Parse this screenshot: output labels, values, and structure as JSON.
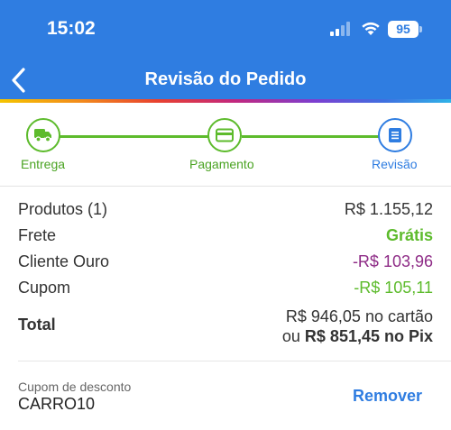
{
  "status_bar": {
    "time": "15:02",
    "battery": "95",
    "icons": [
      "signal-icon",
      "wifi-icon",
      "battery-icon"
    ]
  },
  "header": {
    "title": "Revisão do Pedido",
    "back_icon": "chevron-left-icon"
  },
  "stepper": {
    "steps": [
      {
        "label": "Entrega",
        "icon": "truck-icon",
        "state": "done"
      },
      {
        "label": "Pagamento",
        "icon": "card-icon",
        "state": "done"
      },
      {
        "label": "Revisão",
        "icon": "document-icon",
        "state": "current"
      }
    ]
  },
  "summary": {
    "rows": [
      {
        "label": "Produtos (1)",
        "value": "R$ 1.155,12"
      },
      {
        "label": "Frete",
        "value": "Grátis"
      },
      {
        "label": "Cliente Ouro",
        "value": "-R$ 103,96"
      },
      {
        "label": "Cupom",
        "value": "-R$ 105,11"
      }
    ],
    "total": {
      "label": "Total",
      "card_line": "R$ 946,05 no cartão",
      "pix_prefix": "ou",
      "pix_value": "R$ 851,45 no Pix"
    }
  },
  "coupon": {
    "caption": "Cupom de desconto",
    "code": "CARRO10",
    "remove_label": "Remover"
  },
  "colors": {
    "header_blue": "#2f7de1",
    "step_green": "#5dbb2c",
    "discount_purple": "#8e2b86"
  }
}
